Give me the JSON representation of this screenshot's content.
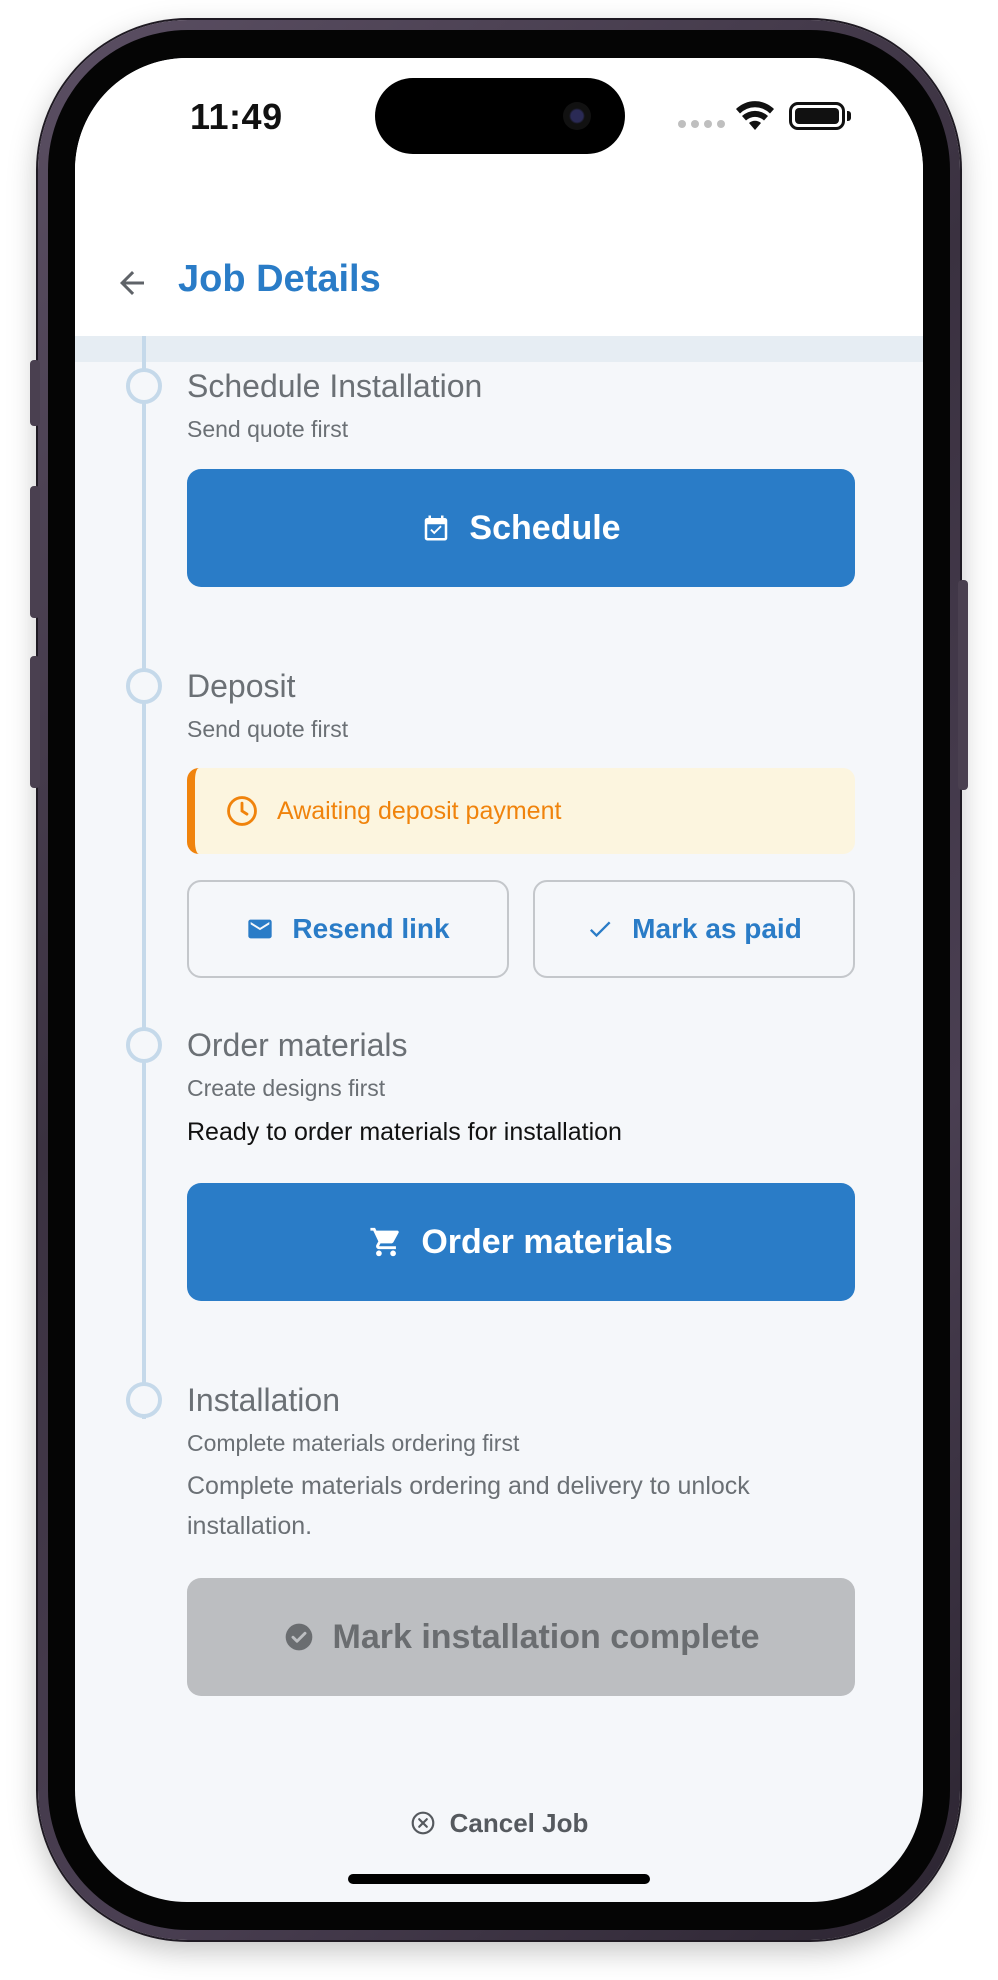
{
  "status_bar": {
    "time": "11:49"
  },
  "header": {
    "title": "Job Details"
  },
  "steps": [
    {
      "title": "Schedule Installation",
      "subtitle": "Send quote first",
      "button_label": "Schedule",
      "button_icon": "calendar-check-icon"
    },
    {
      "title": "Deposit",
      "subtitle": "Send quote first",
      "alert_text": "Awaiting deposit payment",
      "alert_icon": "clock-icon",
      "actions": [
        {
          "label": "Resend link",
          "icon": "mail-icon"
        },
        {
          "label": "Mark as paid",
          "icon": "check-icon"
        }
      ]
    },
    {
      "title": "Order materials",
      "subtitle": "Create designs first",
      "body": "Ready to order materials for installation",
      "button_label": "Order materials",
      "button_icon": "cart-icon"
    },
    {
      "title": "Installation",
      "subtitle": "Complete materials ordering first",
      "body": "Complete materials ordering and delivery to unlock installation.",
      "button_label": "Mark installation complete",
      "button_icon": "check-circle-icon",
      "button_disabled": true
    }
  ],
  "footer": {
    "cancel_label": "Cancel Job",
    "cancel_icon": "close-circle-icon"
  },
  "colors": {
    "primary": "#2a7cc7",
    "warning": "#f0830c",
    "warning_bg": "#fcf5df",
    "disabled_bg": "#bcbec1",
    "timeline": "#c5d9ea"
  }
}
